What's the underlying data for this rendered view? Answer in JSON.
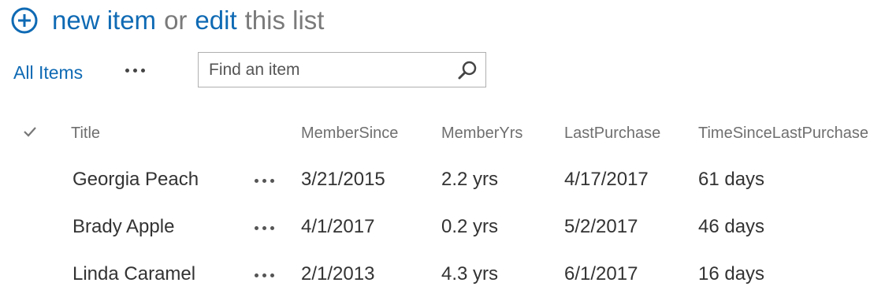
{
  "header": {
    "add_icon": "plus-circle-icon",
    "new_item": "new item",
    "or": "or",
    "edit": "edit",
    "this_list": "this list"
  },
  "view": {
    "all_items": "All Items",
    "more_icon": "ellipsis-icon"
  },
  "search": {
    "placeholder": "Find an item",
    "icon": "search-icon"
  },
  "table": {
    "select_icon": "checkmark-icon",
    "columns": [
      "Title",
      "MemberSince",
      "MemberYrs",
      "LastPurchase",
      "TimeSinceLastPurchase"
    ],
    "rows": [
      {
        "title": "Georgia Peach",
        "member_since": "3/21/2015",
        "member_yrs": "2.2 yrs",
        "last_purchase": "4/17/2017",
        "time_since": "61 days"
      },
      {
        "title": "Brady Apple",
        "member_since": "4/1/2017",
        "member_yrs": "0.2 yrs",
        "last_purchase": "5/2/2017",
        "time_since": "46 days"
      },
      {
        "title": "Linda Caramel",
        "member_since": "2/1/2013",
        "member_yrs": "4.3 yrs",
        "last_purchase": "6/1/2017",
        "time_since": "16 days"
      }
    ]
  },
  "colors": {
    "link_blue": "#0f6ab4",
    "heading_grey": "#7a7a7a",
    "column_header": "#6f6f6f",
    "cell_text": "#333333",
    "search_border": "#b0b0b0"
  }
}
